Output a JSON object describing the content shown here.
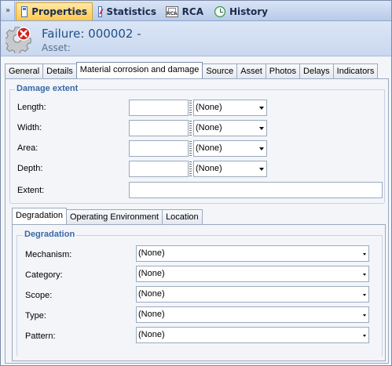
{
  "top_tabs": [
    {
      "label": "Properties",
      "icon": "properties-icon",
      "active": true
    },
    {
      "label": "Statistics",
      "icon": "statistics-icon"
    },
    {
      "label": "RCA",
      "icon": "rca-icon"
    },
    {
      "label": "History",
      "icon": "history-icon"
    }
  ],
  "header": {
    "title": "Failure: 000002 -",
    "asset_label": "Asset:"
  },
  "main_tabs": [
    "General",
    "Details",
    "Material corrosion and damage",
    "Source",
    "Asset",
    "Photos",
    "Delays",
    "Indicators"
  ],
  "damage_extent": {
    "title": "Damage extent",
    "rows": [
      {
        "label": "Length:",
        "value": "",
        "unit": "(None)"
      },
      {
        "label": "Width:",
        "value": "",
        "unit": "(None)"
      },
      {
        "label": "Area:",
        "value": "",
        "unit": "(None)"
      },
      {
        "label": "Depth:",
        "value": "",
        "unit": "(None)"
      }
    ],
    "extent_label": "Extent:",
    "extent_value": ""
  },
  "sub_tabs": [
    "Degradation",
    "Operating Environment",
    "Location"
  ],
  "degradation": {
    "title": "Degradation",
    "fields": [
      {
        "label": "Mechanism:",
        "value": "(None)"
      },
      {
        "label": "Category:",
        "value": "(None)"
      },
      {
        "label": "Scope:",
        "value": "(None)"
      },
      {
        "label": "Type:",
        "value": "(None)"
      },
      {
        "label": "Pattern:",
        "value": "(None)"
      }
    ]
  },
  "colors": {
    "accent_tab": "#ffc94d",
    "title_blue": "#1f4f86",
    "group_title": "#3a68a6",
    "error_red": "#d21f1f"
  }
}
